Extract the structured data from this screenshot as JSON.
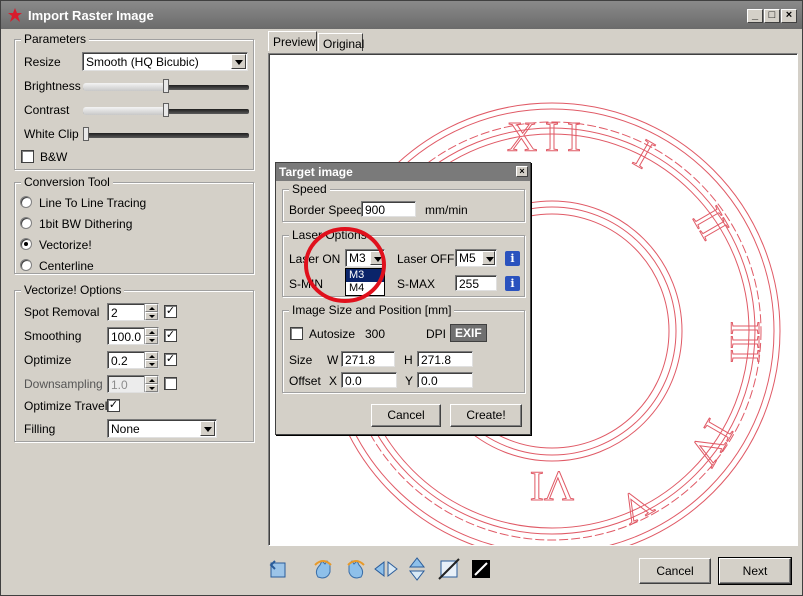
{
  "window": {
    "title": "Import Raster Image"
  },
  "parameters": {
    "title": "Parameters",
    "resize_label": "Resize",
    "resize_value": "Smooth (HQ Bicubic)",
    "brightness_label": "Brightness",
    "contrast_label": "Contrast",
    "whiteclip_label": "White Clip",
    "bw_label": "B&W",
    "bw_checked": false
  },
  "conversion": {
    "title": "Conversion Tool",
    "options": [
      "Line To Line Tracing",
      "1bit BW Dithering",
      "Vectorize!",
      "Centerline"
    ],
    "selected": "Vectorize!"
  },
  "vectorize": {
    "title": "Vectorize! Options",
    "spot_removal_label": "Spot Removal",
    "spot_removal_value": "2",
    "smoothing_label": "Smoothing",
    "smoothing_value": "100.0",
    "optimize_label": "Optimize",
    "optimize_value": "0.2",
    "downsampling_label": "Downsampling",
    "downsampling_value": "1.0",
    "optimize_travel_label": "Optimize Travel",
    "filling_label": "Filling",
    "filling_value": "None"
  },
  "tabs": [
    "Preview",
    "Original"
  ],
  "active_tab": "Preview",
  "dialog": {
    "title": "Target image",
    "speed_title": "Speed",
    "border_speed_label": "Border Speed",
    "border_speed_value": "900",
    "border_speed_unit": "mm/min",
    "laser_title": "Laser Options",
    "laser_on_label": "Laser ON",
    "laser_on_value": "M3",
    "laser_on_options": [
      "M3",
      "M4"
    ],
    "laser_off_label": "Laser OFF",
    "laser_off_value": "M5",
    "smin_label": "S-MIN",
    "smax_label": "S-MAX",
    "smax_value": "255",
    "size_title": "Image Size and Position [mm]",
    "autosize_label": "Autosize",
    "dpi_value": "300",
    "dpi_label": "DPI",
    "exif_label": "EXIF",
    "size_label": "Size",
    "w_label": "W",
    "w_value": "271.8",
    "h_label": "H",
    "h_value": "271.8",
    "offset_label": "Offset",
    "x_label": "X",
    "x_value": "0.0",
    "y_label": "Y",
    "y_value": "0.0",
    "cancel_label": "Cancel",
    "create_label": "Create!"
  },
  "footer": {
    "cancel_label": "Cancel",
    "next_label": "Next"
  },
  "toolbar_icons": [
    "rotate-icon",
    "hand-left-icon",
    "hand-right-icon",
    "flip-horizontal-icon",
    "flip-vertical-icon",
    "crop-icon",
    "invert-icon"
  ],
  "colors": {
    "clock_line": "#e05a66",
    "annotation_circle": "#e0101c",
    "selection": "#0a246a",
    "info_button": "#2a52be"
  }
}
